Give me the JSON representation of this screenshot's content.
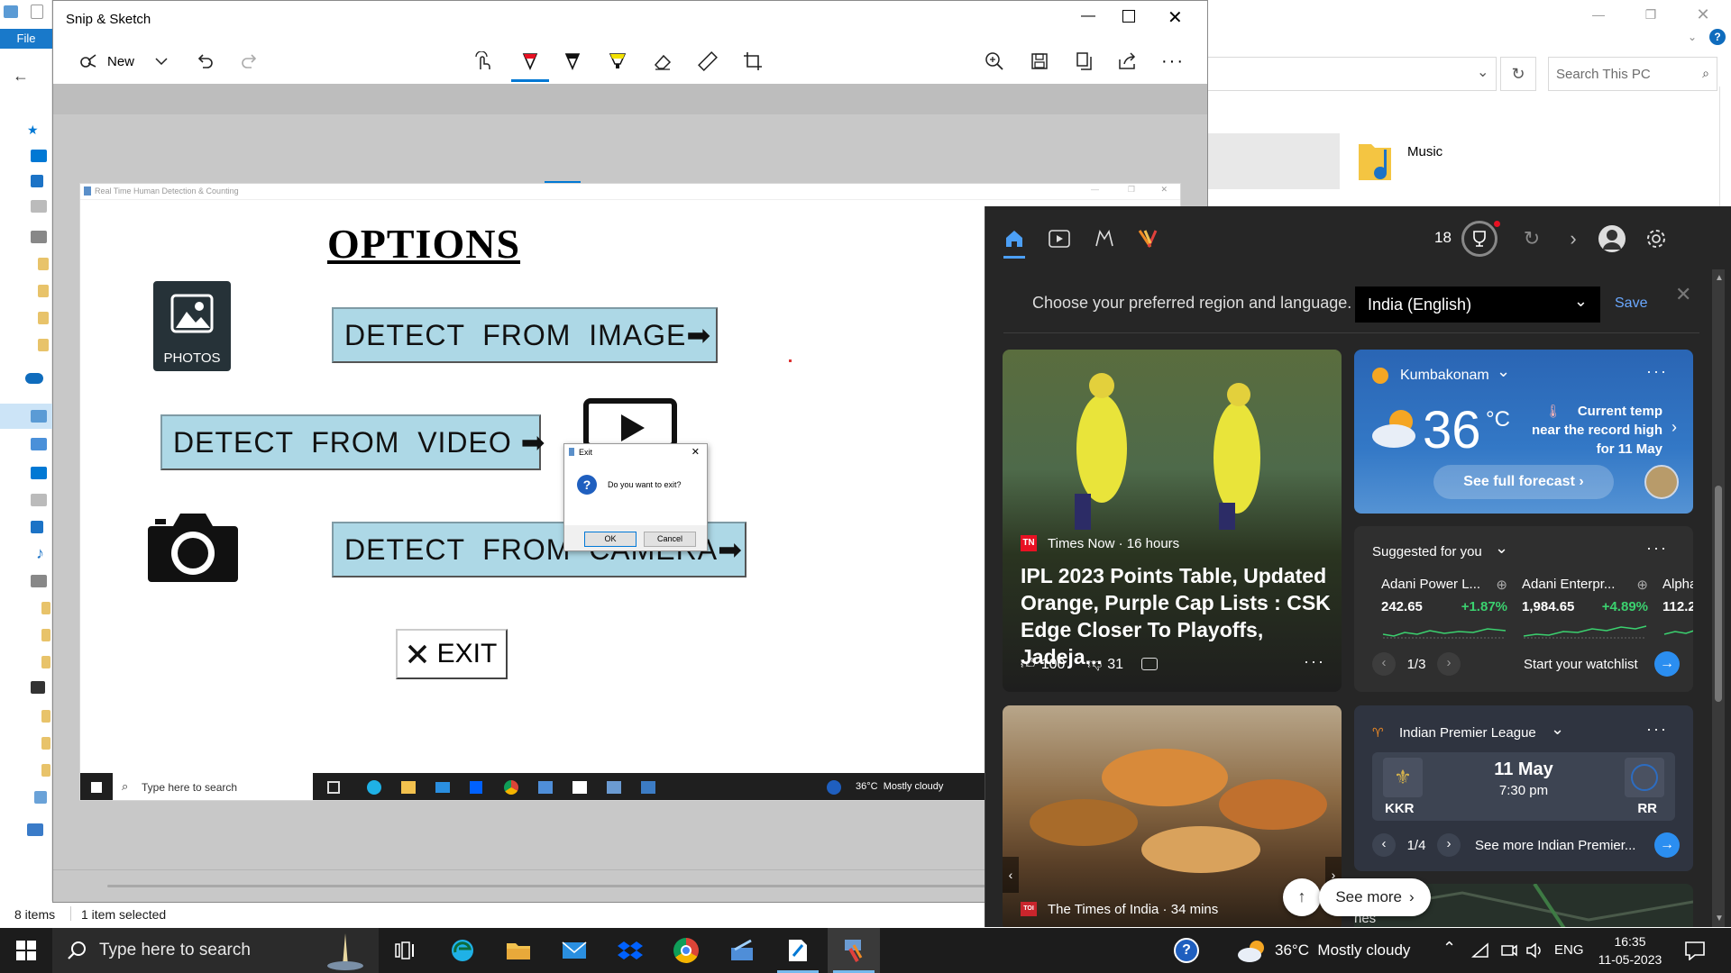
{
  "explorer": {
    "file_tab": "File",
    "search_placeholder": "Search This PC",
    "folder_music": "Music",
    "status_items": "8 items",
    "status_selected": "1 item selected"
  },
  "snip": {
    "title": "Snip & Sketch",
    "new_label": "New"
  },
  "app": {
    "window_title": "Real Time Human Detection & Counting",
    "options_title": "OPTIONS",
    "photos_label": "PHOTOS",
    "btn_image": "DETECT  FROM  IMAGE",
    "btn_video": "DETECT  FROM  VIDEO",
    "btn_camera": "DETECT  FROM  CAMERA",
    "btn_exit": "EXIT",
    "dialog_title": "Exit",
    "dialog_message": "Do you want to exit?",
    "dialog_ok": "OK",
    "dialog_cancel": "Cancel",
    "taskbar_search": "Type here to search",
    "taskbar_weather": "36°C  Mostly cloudy"
  },
  "news": {
    "points": "18",
    "region_prompt": "Choose your preferred region and language.",
    "region_value": "India (English)",
    "save_label": "Save",
    "weather": {
      "location": "Kumbakonam",
      "temp": "36",
      "unit": "°C",
      "note_line1": "Current temp",
      "note_line2": "near the record high",
      "note_line3": "for 11 May",
      "forecast_btn": "See full forecast"
    },
    "article1": {
      "source": "Times Now · 16 hours",
      "headline": "IPL 2023 Points Table, Updated Orange, Purple Cap Lists : CSK Edge Closer To Playoffs, Jadeja...",
      "likes": "100",
      "dislikes": "31"
    },
    "stocks": {
      "header": "Suggested for you",
      "items": [
        {
          "name": "Adani Power L...",
          "price": "242.65",
          "change": "+1.87%"
        },
        {
          "name": "Adani Enterpr...",
          "price": "1,984.65",
          "change": "+4.89%"
        },
        {
          "name": "Alpha",
          "price": "112.2"
        }
      ],
      "pager": "1/3",
      "watchlist": "Start your watchlist"
    },
    "ipl": {
      "header": "Indian Premier League",
      "date": "11 May",
      "time": "7:30 pm",
      "team1": "KKR",
      "team2": "RR",
      "pager": "1/4",
      "more": "See more Indian Premier..."
    },
    "article2": {
      "source": "The Times of India · 34 mins",
      "see_more": "See more",
      "partial": "nes"
    }
  },
  "taskbar": {
    "search_placeholder": "Type here to search",
    "weather": "36°C  Mostly cloudy",
    "lang": "ENG",
    "time": "16:35",
    "date": "11-05-2023"
  },
  "colors": {
    "accent": "#0078d4",
    "tk_button": "#add8e6",
    "news_bg": "#262626",
    "positive": "#3bd16f"
  }
}
